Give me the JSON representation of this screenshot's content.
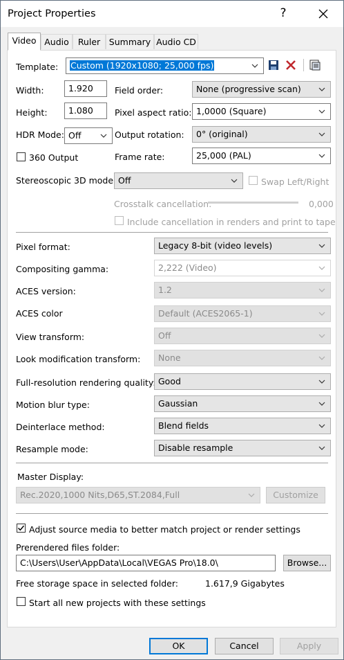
{
  "window": {
    "title": "Project Properties",
    "help_label": "?",
    "close_label": "✕"
  },
  "tabs": [
    "Video",
    "Audio",
    "Ruler",
    "Summary",
    "Audio CD"
  ],
  "template": {
    "label": "Template:",
    "value": "Custom (1920x1080; 25,000 fps)"
  },
  "width": {
    "label": "Width:",
    "value": "1.920"
  },
  "height": {
    "label": "Height:",
    "value": "1.080"
  },
  "hdr": {
    "label": "HDR Mode:",
    "value": "Off"
  },
  "output360": {
    "label": "360 Output"
  },
  "field_order": {
    "label": "Field order:",
    "value": "None (progressive scan)"
  },
  "pixel_aspect": {
    "label": "Pixel aspect ratio:",
    "value": "1,0000 (Square)"
  },
  "output_rotation": {
    "label": "Output rotation:",
    "value": "0° (original)"
  },
  "frame_rate": {
    "label": "Frame rate:",
    "value": "25,000 (PAL)"
  },
  "stereo": {
    "label": "Stereoscopic 3D mode:",
    "value": "Off",
    "swap_label": "Swap Left/Right"
  },
  "crosstalk": {
    "label": "Crosstalk cancellation:",
    "value": "0,000",
    "include_label": "Include cancellation in renders and print to tape"
  },
  "pixel_format": {
    "label": "Pixel format:",
    "value": "Legacy 8-bit (video levels)"
  },
  "compositing_gamma": {
    "label": "Compositing gamma:",
    "value": "2,222 (Video)"
  },
  "aces_version": {
    "label": "ACES version:",
    "value": "1.2"
  },
  "aces_color": {
    "label": "ACES color",
    "value": "Default (ACES2065-1)"
  },
  "view_transform": {
    "label": "View transform:",
    "value": "Off"
  },
  "look_mod": {
    "label": "Look modification transform:",
    "value": "None"
  },
  "full_res": {
    "label": "Full-resolution rendering quality:",
    "value": "Good"
  },
  "motion_blur": {
    "label": "Motion blur type:",
    "value": "Gaussian"
  },
  "deinterlace": {
    "label": "Deinterlace method:",
    "value": "Blend fields"
  },
  "resample": {
    "label": "Resample mode:",
    "value": "Disable resample"
  },
  "master_display": {
    "label": "Master Display:",
    "value": "Rec.2020,1000 Nits,D65,ST.2084,Full",
    "customize_label": "Customize"
  },
  "adjust_source": {
    "label": "Adjust source media to better match project or render settings"
  },
  "prerendered": {
    "label": "Prerendered files folder:",
    "value": "C:\\Users\\User\\AppData\\Local\\VEGAS Pro\\18.0\\",
    "browse_label": "Browse..."
  },
  "free_storage": {
    "label": "Free storage space in selected folder:",
    "value": "1.617,9 Gigabytes"
  },
  "start_all": {
    "label": "Start all new projects with these settings"
  },
  "footer": {
    "ok": "OK",
    "cancel": "Cancel",
    "apply": "Apply"
  }
}
